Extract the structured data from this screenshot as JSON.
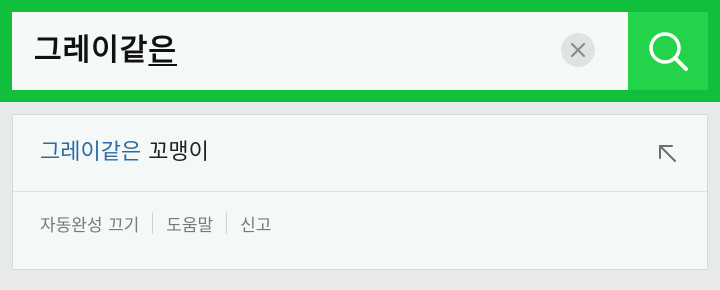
{
  "search": {
    "query_committed": "그레이같",
    "query_composing": "은",
    "clear_icon": "close-icon",
    "submit_icon": "search-icon",
    "brand_color": "#12bf3c",
    "button_color": "#23d44a"
  },
  "autocomplete": {
    "suggestions": [
      {
        "match": "그레이같은",
        "rest": " 꼬맹이",
        "action_icon": "arrow-up-left-icon"
      }
    ],
    "footer": {
      "autocomplete_off": "자동완성 끄기",
      "help": "도움말",
      "report": "신고"
    },
    "match_color": "#2b6ca8"
  }
}
